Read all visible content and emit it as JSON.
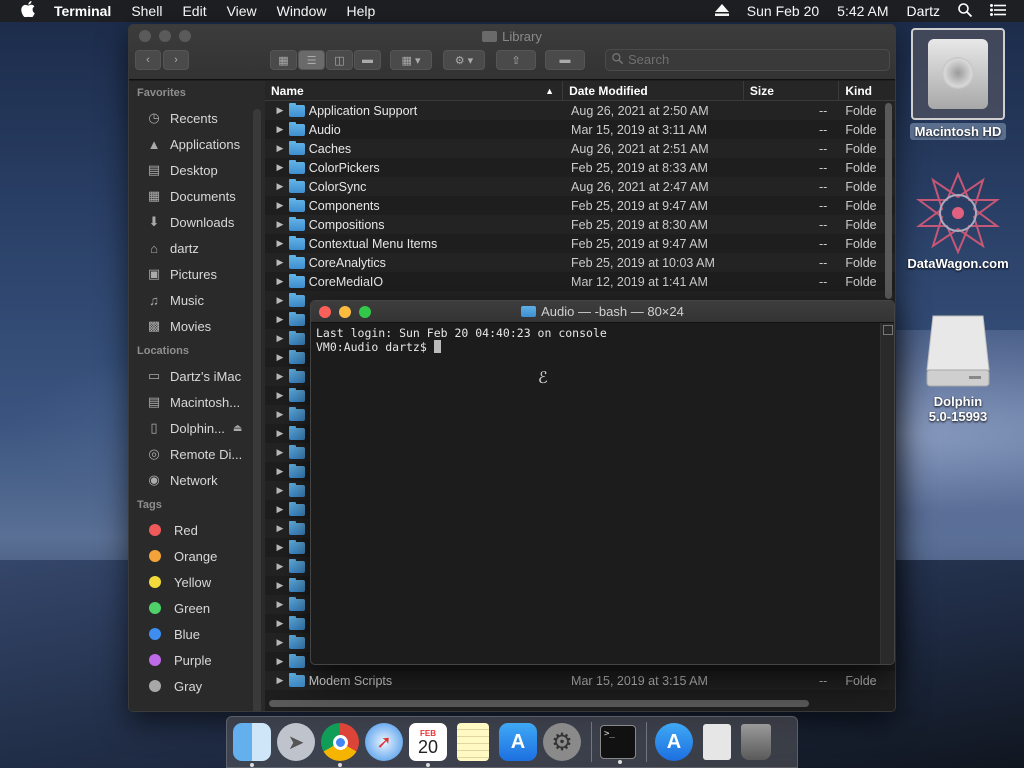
{
  "menubar": {
    "app": "Terminal",
    "items": [
      "Shell",
      "Edit",
      "View",
      "Window",
      "Help"
    ],
    "datetime_date": "Sun Feb 20",
    "datetime_time": "5:42 AM",
    "user": "Dartz"
  },
  "finder": {
    "title": "Library",
    "search_placeholder": "Search",
    "sidebar": {
      "favorites_heading": "Favorites",
      "favorites": [
        "Recents",
        "Applications",
        "Desktop",
        "Documents",
        "Downloads",
        "dartz",
        "Pictures",
        "Music",
        "Movies"
      ],
      "locations_heading": "Locations",
      "locations": [
        "Dartz's iMac",
        "Macintosh...",
        "Dolphin...",
        "Remote Di...",
        "Network"
      ],
      "tags_heading": "Tags",
      "tags": [
        {
          "name": "Red",
          "color": "#ee5a5a"
        },
        {
          "name": "Orange",
          "color": "#f2a33a"
        },
        {
          "name": "Yellow",
          "color": "#f4d93b"
        },
        {
          "name": "Green",
          "color": "#4fd16a"
        },
        {
          "name": "Blue",
          "color": "#3e8ef2"
        },
        {
          "name": "Purple",
          "color": "#c06ae8"
        },
        {
          "name": "Gray",
          "color": "#a8a8a8"
        }
      ]
    },
    "columns": {
      "name": "Name",
      "date": "Date Modified",
      "size": "Size",
      "kind": "Kind"
    },
    "rows": [
      {
        "name": "Application Support",
        "date": "Aug 26, 2021 at 2:50 AM",
        "size": "--",
        "kind": "Folde"
      },
      {
        "name": "Audio",
        "date": "Mar 15, 2019 at 3:11 AM",
        "size": "--",
        "kind": "Folde"
      },
      {
        "name": "Caches",
        "date": "Aug 26, 2021 at 2:51 AM",
        "size": "--",
        "kind": "Folde"
      },
      {
        "name": "ColorPickers",
        "date": "Feb 25, 2019 at 8:33 AM",
        "size": "--",
        "kind": "Folde"
      },
      {
        "name": "ColorSync",
        "date": "Aug 26, 2021 at 2:47 AM",
        "size": "--",
        "kind": "Folde"
      },
      {
        "name": "Components",
        "date": "Feb 25, 2019 at 9:47 AM",
        "size": "--",
        "kind": "Folde"
      },
      {
        "name": "Compositions",
        "date": "Feb 25, 2019 at 8:30 AM",
        "size": "--",
        "kind": "Folde"
      },
      {
        "name": "Contextual Menu Items",
        "date": "Feb 25, 2019 at 9:47 AM",
        "size": "--",
        "kind": "Folde"
      },
      {
        "name": "CoreAnalytics",
        "date": "Feb 25, 2019 at 10:03 AM",
        "size": "--",
        "kind": "Folde"
      },
      {
        "name": "CoreMediaIO",
        "date": "Mar 12, 2019 at 1:41 AM",
        "size": "--",
        "kind": "Folde"
      }
    ],
    "last_row": {
      "name": "Modem Scripts",
      "date": "Mar 15, 2019 at 3:15 AM",
      "size": "--",
      "kind": "Folde"
    }
  },
  "terminal": {
    "title": "Audio — -bash — 80×24",
    "line1": "Last login: Sun Feb 20 04:40:23 on console",
    "prompt": "VM0:Audio dartz$ "
  },
  "desktop": {
    "hd_label": "Macintosh HD",
    "datawagon_label": "DataWagon.com",
    "dolphin_label_1": "Dolphin",
    "dolphin_label_2": "5.0-15993"
  },
  "dock": {
    "calendar_month": "FEB",
    "calendar_day": "20"
  }
}
